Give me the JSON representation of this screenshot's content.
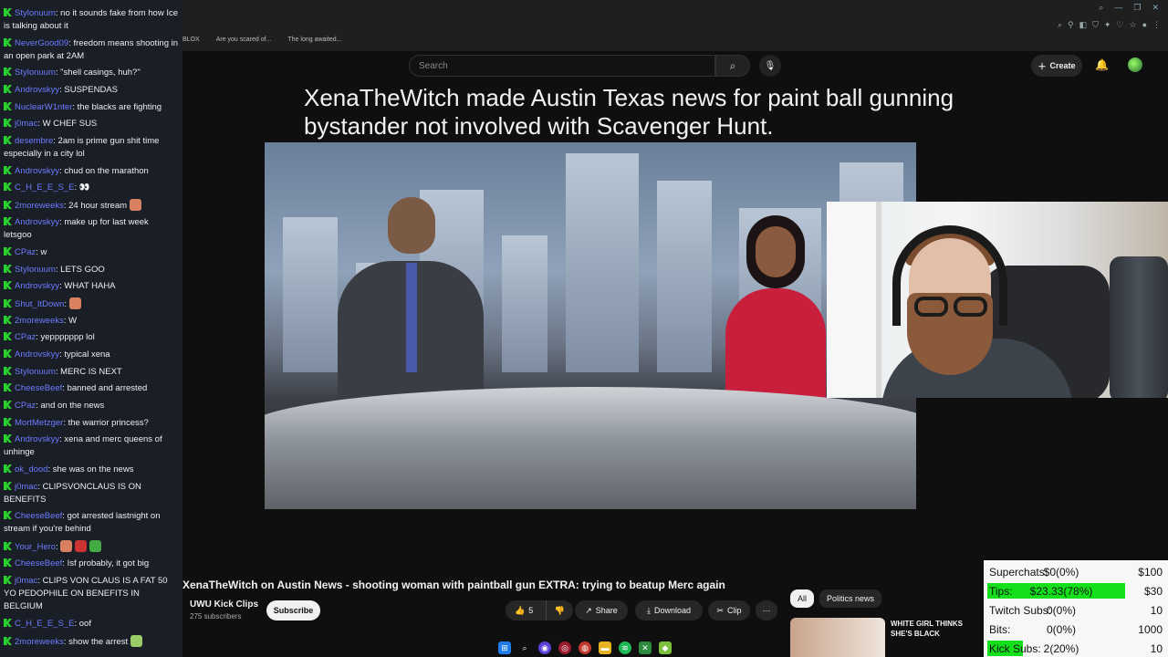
{
  "chat": {
    "messages": [
      {
        "user": "Stylonuum",
        "text": "no it sounds fake from how Ice is talking about it"
      },
      {
        "user": "NeverGood09",
        "text": "freedom means shooting in an open park at 2AM"
      },
      {
        "user": "Stylonuum",
        "text": "\"shell casings, huh?\""
      },
      {
        "user": "Androvskyy",
        "text": "SUSPENDAS"
      },
      {
        "user": "NuclearW1nter",
        "text": "the blacks are fighting"
      },
      {
        "user": "j0mac",
        "text": "W CHEF SUS"
      },
      {
        "user": "desembre",
        "text": "2am is prime gun shit time especially in a city lol"
      },
      {
        "user": "Androvskyy",
        "text": "chud on the marathon"
      },
      {
        "user": "C_H_E_E_S_E",
        "text": "👀"
      },
      {
        "user": "2moreweeks",
        "text": "24 hour stream"
      },
      {
        "user": "Androvskyy",
        "text": "make up for last week letsgoo"
      },
      {
        "user": "CPaz",
        "text": "w"
      },
      {
        "user": "Stylonuum",
        "text": "LETS GOO"
      },
      {
        "user": "Androvskyy",
        "text": "WHAT HAHA"
      },
      {
        "user": "Shut_ItDown",
        "text": ""
      },
      {
        "user": "2moreweeks",
        "text": "W"
      },
      {
        "user": "CPaz",
        "text": "yeppppppp lol"
      },
      {
        "user": "Androvskyy",
        "text": "typical xena"
      },
      {
        "user": "Stylonuum",
        "text": "MERC IS NEXT"
      },
      {
        "user": "CheeseBeef",
        "text": "banned and arrested"
      },
      {
        "user": "CPaz",
        "text": "and on the news"
      },
      {
        "user": "MortMetzger",
        "text": "the warrior princess?"
      },
      {
        "user": "Androvskyy",
        "text": "xena and merc queens of unhinge"
      },
      {
        "user": "ok_dood",
        "text": "she was on the news"
      },
      {
        "user": "j0mac",
        "text": "CLIPSVONCLAUS IS ON BENEFITS"
      },
      {
        "user": "CheeseBeef",
        "text": "got arrested lastnight on stream if you're behind"
      },
      {
        "user": "Your_Hero",
        "text": ""
      },
      {
        "user": "CheeseBeef",
        "text": "Isf probably, it got big"
      },
      {
        "user": "j0mac",
        "text": "CLIPS VON CLAUS IS A FAT 50 YO PEDOPHILE ON BENEFITS IN BELGIUM"
      },
      {
        "user": "C_H_E_E_S_E",
        "text": "oof"
      },
      {
        "user": "2moreweeks",
        "text": "show the arrest"
      }
    ]
  },
  "browser": {
    "bookmarks": [
      "BLOX",
      "Are you scared of...",
      "The long awaited..."
    ]
  },
  "youtube": {
    "search_placeholder": "Search",
    "create_label": "Create",
    "video_caption": "XenaTheWitch made Austin Texas news for paint ball gunning bystander not involved with Scavenger Hunt.",
    "video_title": "XenaTheWitch on Austin News - shooting woman with paintball gun EXTRA: trying to beatup Merc again",
    "channel_name": "UWU Kick Clips",
    "subscribers": "275 subscribers",
    "subscribe_label": "Subscribe",
    "likes": "5",
    "share_label": "Share",
    "download_label": "Download",
    "clip_label": "Clip",
    "chips": [
      "All",
      "Politics news"
    ],
    "rec_title": "WHITE GIRL THINKS SHE'S BLACK"
  },
  "goals": [
    {
      "label": "Superchats:",
      "value": "$0(0%)",
      "target": "$100",
      "fraction": 0.0
    },
    {
      "label": "Tips:",
      "value": "$23.33(78%)",
      "target": "$30",
      "fraction": 0.78
    },
    {
      "label": "Twitch Subs:",
      "value": "0(0%)",
      "target": "10",
      "fraction": 0.0
    },
    {
      "label": "Bits:",
      "value": "0(0%)",
      "target": "1000",
      "fraction": 0.0
    },
    {
      "label": "Kick Subs:",
      "value": "2(20%)",
      "target": "10",
      "fraction": 0.2
    }
  ],
  "colors": {
    "goal_fill": "#13e01a",
    "chat_badge": "#29d22e",
    "chat_user": "#6b7cff"
  }
}
